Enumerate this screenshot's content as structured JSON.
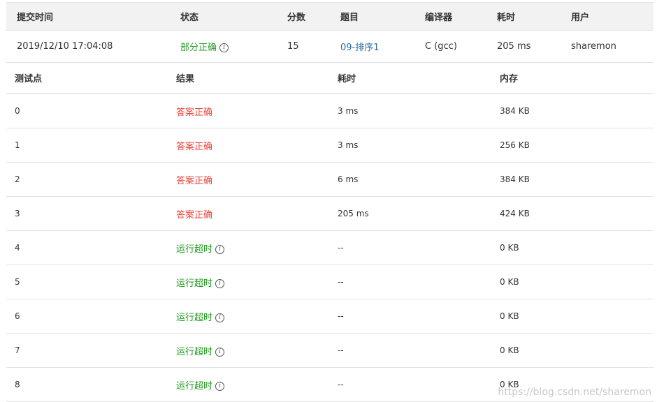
{
  "submission": {
    "headers": [
      "提交时间",
      "状态",
      "分数",
      "题目",
      "编译器",
      "耗时",
      "用户"
    ],
    "time": "2019/12/10 17:04:08",
    "status": "部分正确",
    "score": "15",
    "problem": "09-排序1",
    "compiler": "C (gcc)",
    "duration": "205 ms",
    "user": "sharemon"
  },
  "cases": {
    "headers": [
      "测试点",
      "结果",
      "耗时",
      "内存"
    ],
    "rows": [
      {
        "id": "0",
        "result": "答案正确",
        "type": "ac",
        "time": "3 ms",
        "memory": "384 KB"
      },
      {
        "id": "1",
        "result": "答案正确",
        "type": "ac",
        "time": "3 ms",
        "memory": "256 KB"
      },
      {
        "id": "2",
        "result": "答案正确",
        "type": "ac",
        "time": "6 ms",
        "memory": "384 KB"
      },
      {
        "id": "3",
        "result": "答案正确",
        "type": "ac",
        "time": "205 ms",
        "memory": "424 KB"
      },
      {
        "id": "4",
        "result": "运行超时",
        "type": "tle",
        "time": "--",
        "memory": "0 KB"
      },
      {
        "id": "5",
        "result": "运行超时",
        "type": "tle",
        "time": "--",
        "memory": "0 KB"
      },
      {
        "id": "6",
        "result": "运行超时",
        "type": "tle",
        "time": "--",
        "memory": "0 KB"
      },
      {
        "id": "7",
        "result": "运行超时",
        "type": "tle",
        "time": "--",
        "memory": "0 KB"
      },
      {
        "id": "8",
        "result": "运行超时",
        "type": "tle",
        "time": "--",
        "memory": "0 KB"
      }
    ]
  },
  "watermark": "https://blog.csdn.net/sharemon",
  "colors": {
    "partial": "#2a9d2a",
    "accepted": "#e8453c",
    "timeout": "#1f9a1f",
    "link": "#2c6ca0"
  },
  "icons": {
    "info": "info-circle-icon"
  }
}
